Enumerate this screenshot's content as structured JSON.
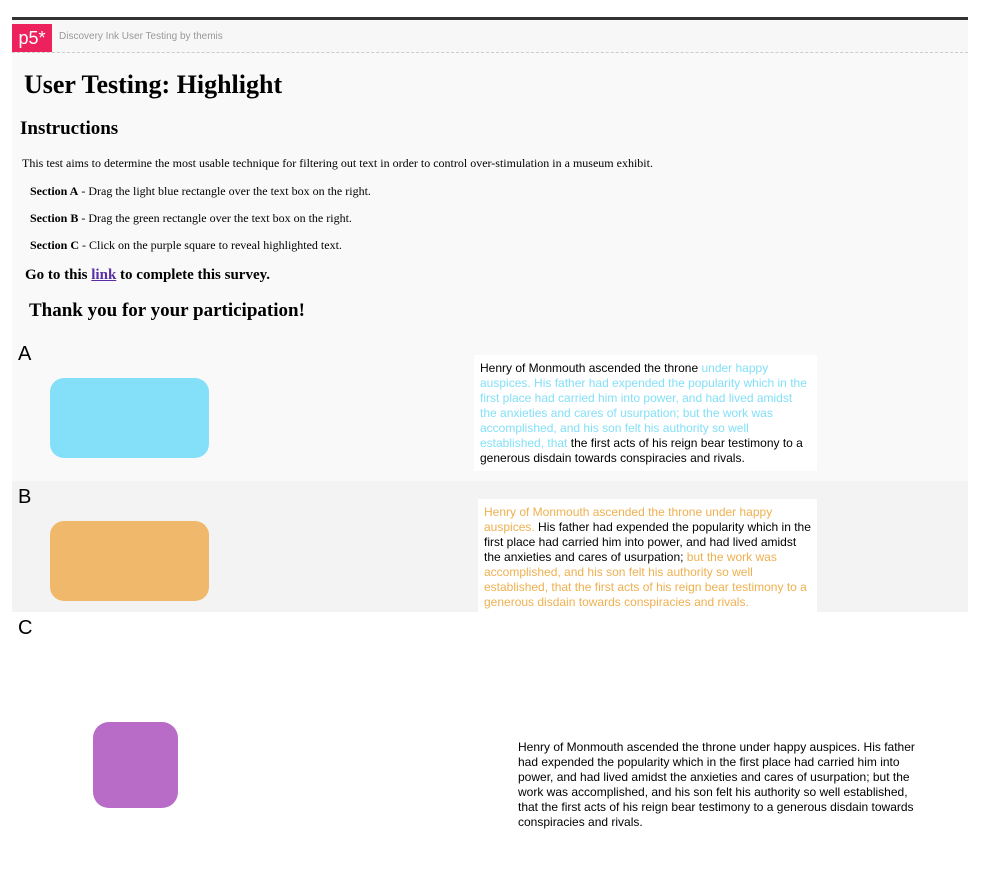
{
  "header": {
    "logo": "p5*",
    "title": "Discovery Ink User Testing by themis"
  },
  "page": {
    "title": "User Testing: Highlight",
    "instructions_heading": "Instructions",
    "intro": "This test aims to determine the most usable technique for filtering out text in order to control over-stimulation in a museum exhibit.",
    "steps": [
      {
        "label": "Section A",
        "text": " - Drag the light blue rectangle over the text box on the right."
      },
      {
        "label": "Section B",
        "text": " - Drag the green rectangle over the text box on the right."
      },
      {
        "label": "Section C",
        "text": " - Click on the purple square to reveal highlighted text."
      }
    ],
    "survey": {
      "before": "Go to this ",
      "link": "link",
      "after": " to complete this survey."
    },
    "thanks": "Thank you for your participation!"
  },
  "sections": {
    "a": {
      "label": "A",
      "color": "#84e0f8",
      "text_plain_start": "Henry of Monmouth ascended the throne ",
      "text_highlight": "under happy auspices. His father had expended the popularity which in the first place had carried him into power, and had lived amidst the anxieties and cares of usurpation; but the work was accomplished, and his son felt his authority so well established, that",
      "text_plain_end": " the first acts of his reign bear testimony to a generous disdain towards conspiracies and rivals."
    },
    "b": {
      "label": "B",
      "color": "#efb86a",
      "text_highlight_1": "Henry of Monmouth ascended the throne under happy auspices.",
      "text_plain": " His father had expended the popularity which in the first place had carried him into power, and had lived amidst the anxieties and cares of usurpation;",
      "text_highlight_2": " but the work was accomplished, and his son felt his authority so well established, that the first acts of his reign bear testimony to a generous disdain towards conspiracies and rivals."
    },
    "c": {
      "label": "C",
      "color": "#b86cc8",
      "text": "Henry of Monmouth ascended the throne under happy auspices. His father had expended the popularity which in the first place had carried him into power, and had lived amidst the anxieties and cares of usurpation; but the work was accomplished, and his son felt his authority so well established, that the first acts of his reign bear testimony to a generous disdain towards conspiracies and rivals."
    }
  }
}
